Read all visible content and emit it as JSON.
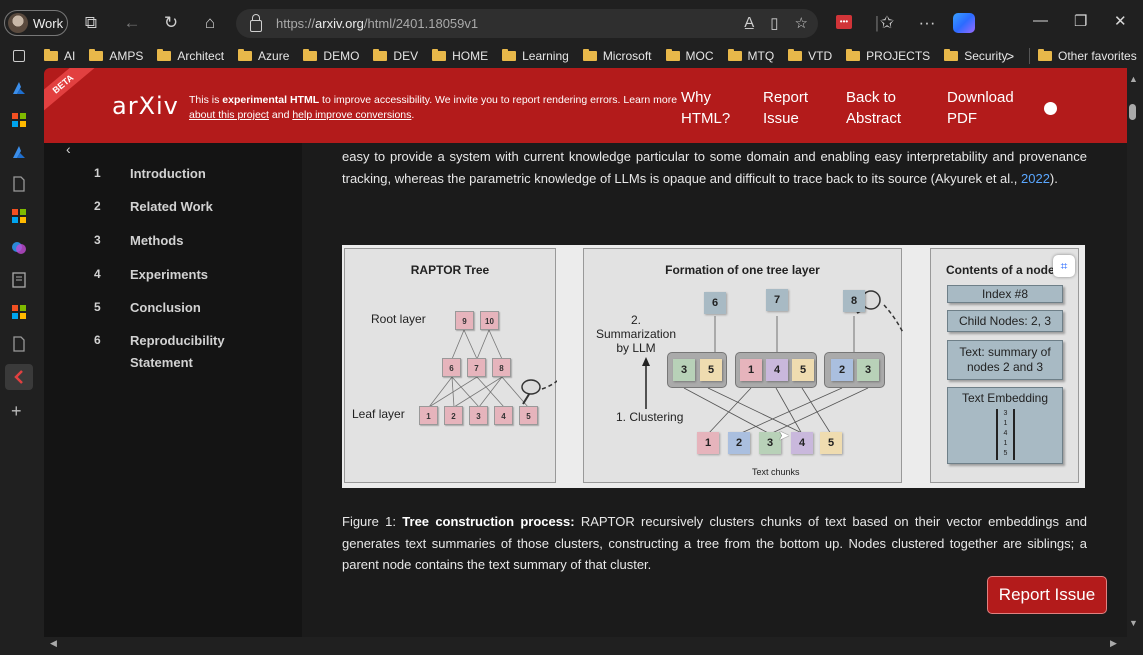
{
  "browser": {
    "profile_label": "Work",
    "url_prefix": "https://",
    "url_domain": "arxiv.org",
    "url_path": "/html/2401.18059v1",
    "bookmarks": [
      "AI",
      "AMPS",
      "Architect",
      "Azure",
      "DEMO",
      "DEV",
      "HOME",
      "Learning",
      "Microsoft",
      "MOC",
      "MTQ",
      "VTD",
      "PROJECTS",
      "Security"
    ],
    "other_favorites": "Other favorites",
    "more_chevron": ">"
  },
  "banner": {
    "beta": "BETA",
    "logo": "arXiv",
    "text_prefix": "This is ",
    "text_bold": "experimental HTML",
    "text_rest": " to improve accessibility. We invite you to report rendering errors. Learn more ",
    "link1": "about this project",
    "text_and": " and ",
    "link2": "help improve conversions",
    "text_end": ".",
    "why_html": "Why HTML?",
    "report_issue": "Report Issue",
    "back_to_abstract": "Back to Abstract",
    "download_pdf": "Download PDF"
  },
  "toc": {
    "items": [
      {
        "num": "1",
        "label": "Introduction"
      },
      {
        "num": "2",
        "label": "Related Work"
      },
      {
        "num": "3",
        "label": "Methods"
      },
      {
        "num": "4",
        "label": "Experiments"
      },
      {
        "num": "5",
        "label": "Conclusion"
      },
      {
        "num": "6",
        "label": "Reproducibility Statement"
      }
    ]
  },
  "content": {
    "para_text": "easy to provide a system with current knowledge particular to some domain and enabling easy interpretability and provenance tracking, whereas the parametric knowledge of LLMs is opaque and difficult to trace back to its source (Akyurek et al., ",
    "para_cite": "2022",
    "para_end": ").",
    "figure": {
      "panel1_title": "RAPTOR Tree",
      "root_layer": "Root layer",
      "leaf_layer": "Leaf layer",
      "root_nodes": [
        "9",
        "10"
      ],
      "mid_nodes": [
        "6",
        "7",
        "8"
      ],
      "leaf_nodes": [
        "1",
        "2",
        "3",
        "4",
        "5"
      ],
      "panel2_title": "Formation of one tree layer",
      "summarization": "2. Summarization by LLM",
      "clustering": "1. Clustering",
      "text_chunks": "Text chunks",
      "top_nodes": [
        "6",
        "7",
        "8"
      ],
      "clusters": [
        [
          "3",
          "5"
        ],
        [
          "1",
          "4",
          "5"
        ],
        [
          "2",
          "3"
        ]
      ],
      "chunks": [
        "1",
        "2",
        "3",
        "4",
        "5"
      ],
      "panel3_title": "Contents of a node",
      "index": "Index #8",
      "child_nodes": "Child Nodes: 2, 3",
      "text_summary": "Text: summary of nodes 2 and 3",
      "text_embedding": "Text Embedding",
      "embedding_values": [
        "3",
        "1",
        "4",
        "1",
        "5"
      ]
    },
    "caption_label": "Figure 1: ",
    "caption_bold": "Tree construction process:",
    "caption_text": " RAPTOR recursively clusters chunks of text based on their vector embeddings and generates text summaries of those clusters, constructing a tree from the bottom up. Nodes clustered together are siblings; a parent node contains the text summary of that cluster.",
    "report_issue_button": "Report Issue"
  },
  "colors": {
    "arxiv_red": "#b31b1b",
    "box_pink": "#e6b4bc",
    "box_blue": "#aabfdf",
    "box_green": "#b8d1b8",
    "box_purple": "#c9b8dc",
    "box_yellow": "#efdcb0",
    "node_gray": "#a8bac4"
  }
}
